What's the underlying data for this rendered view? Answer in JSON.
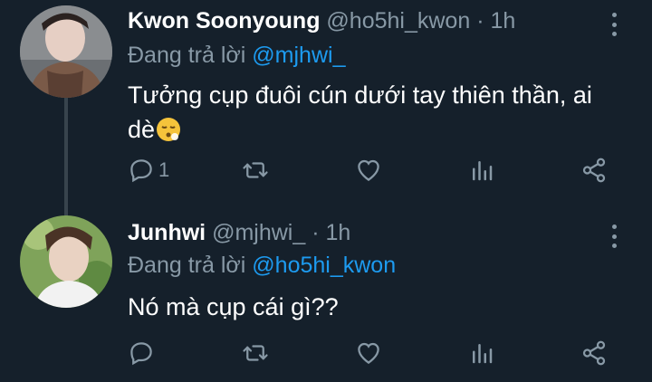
{
  "tweets": [
    {
      "name": "Kwon Soonyoung",
      "handle": "@ho5hi_kwon",
      "time": "· 1h",
      "reply_prefix": "Đang trả lời",
      "reply_to": "@mjhwi_",
      "text": "Tưởng cụp đuôi cún dưới tay thiên thần, ai dè",
      "emoji": "face-exhaling-emoji",
      "reply_count": "1"
    },
    {
      "name": "Junhwi",
      "handle": "@mjhwi_",
      "time": "· 1h",
      "reply_prefix": "Đang trả lời",
      "reply_to": "@ho5hi_kwon",
      "text": "Nó mà cụp cái gì??",
      "reply_count": ""
    }
  ],
  "icons": [
    "reply-icon",
    "retweet-icon",
    "like-icon",
    "analytics-icon",
    "share-icon",
    "more-icon"
  ],
  "colors": {
    "background": "#15202b",
    "muted": "#8899a6",
    "accent": "#1d9bf0",
    "text": "#ffffff"
  }
}
